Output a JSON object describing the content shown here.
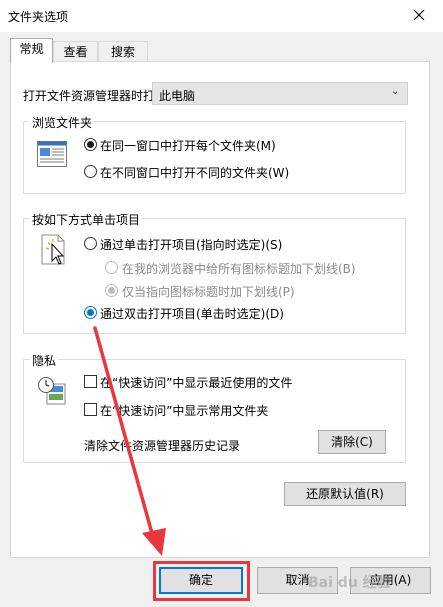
{
  "window": {
    "title": "文件夹选项"
  },
  "tabs": [
    {
      "label": "常规"
    },
    {
      "label": "查看"
    },
    {
      "label": "搜索"
    }
  ],
  "general": {
    "open_explorer_label": "打开文件资源管理器时打",
    "open_explorer_value": "此电脑",
    "browse": {
      "title": "浏览文件夹",
      "options": [
        {
          "label": "在同一窗口中打开每个文件夹(M)",
          "checked": true
        },
        {
          "label": "在不同窗口中打开不同的文件夹(W)",
          "checked": false
        }
      ]
    },
    "click": {
      "title": "按如下方式单击项目",
      "single": "通过单击打开项目(指向时选定)(S)",
      "sub_all": "在我的浏览器中给所有图标标题加下划线(B)",
      "sub_point": "仅当指向图标标题时加下划线(P)",
      "double": "通过双击打开项目(单击时选定)(D)"
    },
    "privacy": {
      "title": "隐私",
      "recent": "在“快速访问”中显示最近使用的文件",
      "frequent": "在“快速访问”中显示常用文件夹",
      "clear_label": "清除文件资源管理器历史记录",
      "clear_button": "清除(C)"
    },
    "restore_button": "还原默认值(R)"
  },
  "footer": {
    "ok": "确定",
    "cancel": "取消",
    "apply": "应用(A)"
  },
  "watermark": "Bai du 经验",
  "colors": {
    "accent": "#0078d7",
    "annotation": "#e8383d"
  }
}
